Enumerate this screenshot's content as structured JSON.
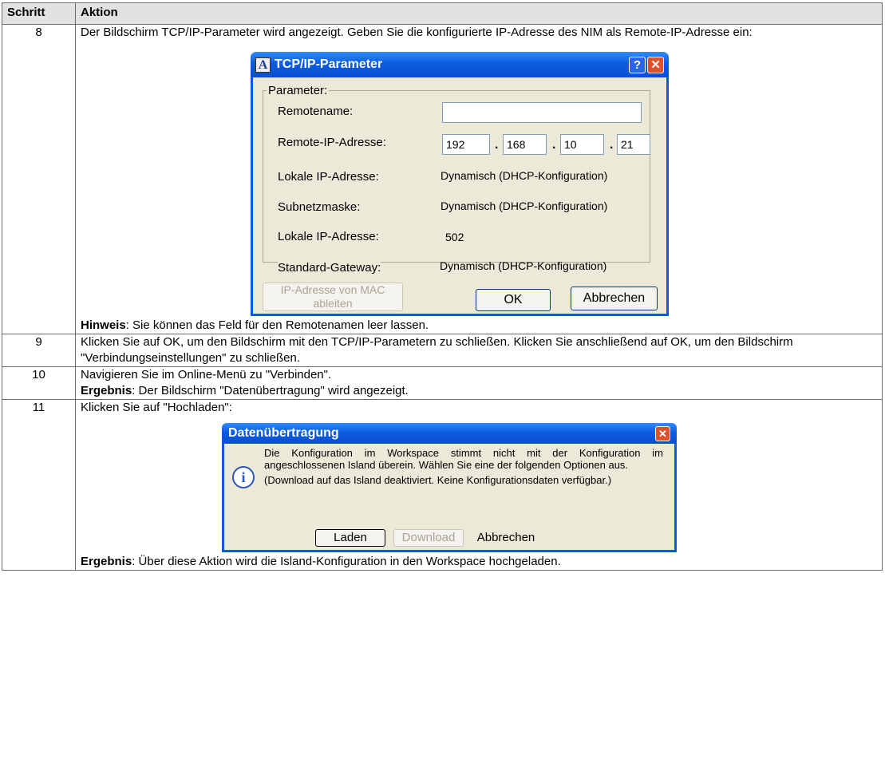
{
  "table": {
    "header": {
      "col1": "Schritt",
      "col2": "Aktion"
    },
    "rows": {
      "r8": {
        "step": "8",
        "intro": "Der Bildschirm TCP/IP-Parameter wird angezeigt. Geben Sie die konfigurierte IP-Adresse des NIM als Remote-IP-Adresse ein:",
        "note_label": "Hinweis",
        "note_text": ": Sie können das Feld für den Remotenamen leer lassen."
      },
      "r9": {
        "step": "9",
        "text": "Klicken Sie auf OK, um den Bildschirm mit den TCP/IP-Parametern zu schließen. Klicken Sie anschließend auf OK, um den Bildschirm \"Verbindungseinstellungen\" zu schließen."
      },
      "r10": {
        "step": "10",
        "text": "Navigieren Sie im Online-Menü zu \"Verbinden\".",
        "result_label": "Ergebnis",
        "result_text": ": Der Bildschirm \"Datenübertragung\" wird angezeigt."
      },
      "r11": {
        "step": "11",
        "text": "Klicken Sie auf \"Hochladen\":",
        "result_label": "Ergebnis",
        "result_text": ": Über diese Aktion wird die Island-Konfiguration in den Workspace hochgeladen."
      }
    }
  },
  "tcp_dialog": {
    "title": "TCP/IP-Parameter",
    "app_icon_letter": "A",
    "help_glyph": "?",
    "close_glyph": "✕",
    "group_label": "Parameter:",
    "remotename_label": "Remotename:",
    "remotename_value": "",
    "remote_ip_label": "Remote-IP-Adresse:",
    "ip_octets": [
      "192",
      "168",
      "10",
      "21"
    ],
    "ip_dot": ".",
    "local_ip_label": "Lokale IP-Adresse:",
    "local_ip_value": "Dynamisch (DHCP-Konfiguration)",
    "subnet_label": "Subnetzmaske:",
    "subnet_value": "Dynamisch (DHCP-Konfiguration)",
    "local_ip2_label": "Lokale IP-Adresse:",
    "local_ip2_value": "502",
    "gateway_label": "Standard-Gateway:",
    "gateway_value": "Dynamisch (DHCP-Konfiguration)",
    "derive_button_line1": "IP-Adresse von MAC",
    "derive_button_line2": "ableiten",
    "ok_button": "OK",
    "cancel_button": "Abbrechen"
  },
  "transfer_dialog": {
    "title": "Datenübertragung",
    "close_glyph": "✕",
    "info_glyph": "i",
    "message": "Die Konfiguration im Workspace stimmt nicht mit der Konfiguration im angeschlossenen Island überein. Wählen Sie eine der folgenden Optionen aus.",
    "submessage": "(Download auf das Island deaktiviert. Keine Konfigurationsdaten verfügbar.)",
    "load_button": "Laden",
    "download_button": "Download",
    "cancel_button": "Abbrechen"
  },
  "colors": {
    "titlebar": "#0a5ae0",
    "dialog_bg": "#ece9d8",
    "close_button": "#e0502a",
    "header_bg": "#e2e2e2"
  }
}
